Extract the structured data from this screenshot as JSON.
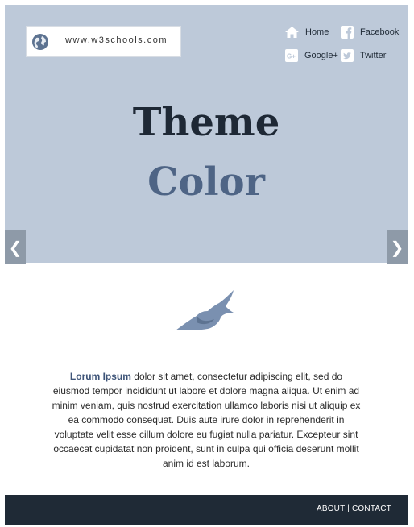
{
  "logo": {
    "text": "www.w3schools.com",
    "icon": "globe-icon"
  },
  "nav": [
    {
      "label": "Home",
      "icon": "home-icon"
    },
    {
      "label": "Facebook",
      "icon": "facebook-icon"
    },
    {
      "label": "Google+",
      "icon": "google-plus-icon"
    },
    {
      "label": "Twitter",
      "icon": "twitter-icon"
    }
  ],
  "hero": {
    "line1": "Theme",
    "line2": "Color",
    "prev": "❮",
    "next": "❯"
  },
  "content": {
    "lead": "Lorum Ipsum",
    "text": " dolor sit amet, consectetur adipiscing elit, sed do eiusmod tempor incididunt ut labore et dolore magna aliqua. Ut enim ad minim veniam, quis nostrud exercitation ullamco laboris nisi ut aliquip ex ea commodo consequat. Duis aute irure dolor in reprehenderit in voluptate velit esse cillum dolore eu fugiat nulla pariatur. Excepteur sint occaecat cupidatat non proident, sunt in culpa qui officia deserunt mollit anim id est laborum."
  },
  "footer": {
    "about": "ABOUT",
    "separator": " | ",
    "contact": "CONTACT"
  },
  "colors": {
    "hero_bg": "#bdc9d9",
    "dark": "#1f2a36",
    "accent": "#4e6485"
  }
}
